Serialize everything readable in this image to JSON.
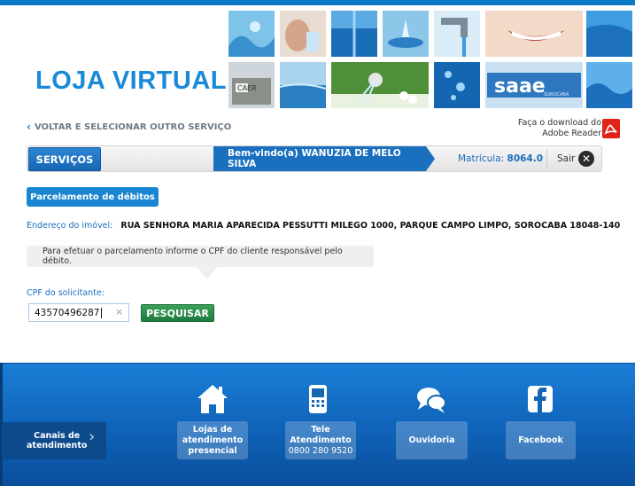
{
  "header": {
    "logo_text": "LOJA VIRTUAL",
    "banner_badge": "saae",
    "banner_badge_sub": "SOROCABA",
    "caer_label": "CAER"
  },
  "nav": {
    "back_label": "VOLTAR E SELECIONAR OUTRO SERVIÇO",
    "download_line1": "Faça o download do",
    "download_line2": "Adobe Reader",
    "servicos_label": "SERVIÇOS",
    "welcome_label": "Bem-vindo(a) WANUZIA DE MELO SILVA",
    "matricula_label": "Matrícula:",
    "matricula_value": "8064.0",
    "sair_label": "Sair"
  },
  "main": {
    "tab_label": "Parcelamento de débitos",
    "address_label": "Endereço do imóvel:",
    "address_value": "RUA SENHORA MARIA APARECIDA PESSUTTI MILEGO 1000, PARQUE CAMPO LIMPO, SOROCABA 18048-140",
    "info_text": "Para efetuar o parcelamento informe o CPF do cliente responsável pelo débito.",
    "cpf_label": "CPF do solicitante:",
    "cpf_value": "43570496287",
    "clear_symbol": "×",
    "search_label": "PESQUISAR"
  },
  "footer": {
    "canais_line1": "Canais de",
    "canais_line2": "atendimento",
    "buttons": [
      {
        "line1": "Lojas de",
        "line2": "atendimento",
        "line3": "presencial",
        "icon": "house-icon"
      },
      {
        "line1": "Tele",
        "line2": "Atendimento",
        "line3": "0800 280 9520",
        "icon": "phone-icon"
      },
      {
        "line1": "Ouvidoria",
        "icon": "chat-icon"
      },
      {
        "line1": "Facebook",
        "icon": "facebook-icon"
      }
    ]
  },
  "colors": {
    "brand_blue": "#1a86d2",
    "dark_blue": "#1a6fbf",
    "search_green": "#2a8a4a",
    "footer_blue": "#0e60b5"
  }
}
